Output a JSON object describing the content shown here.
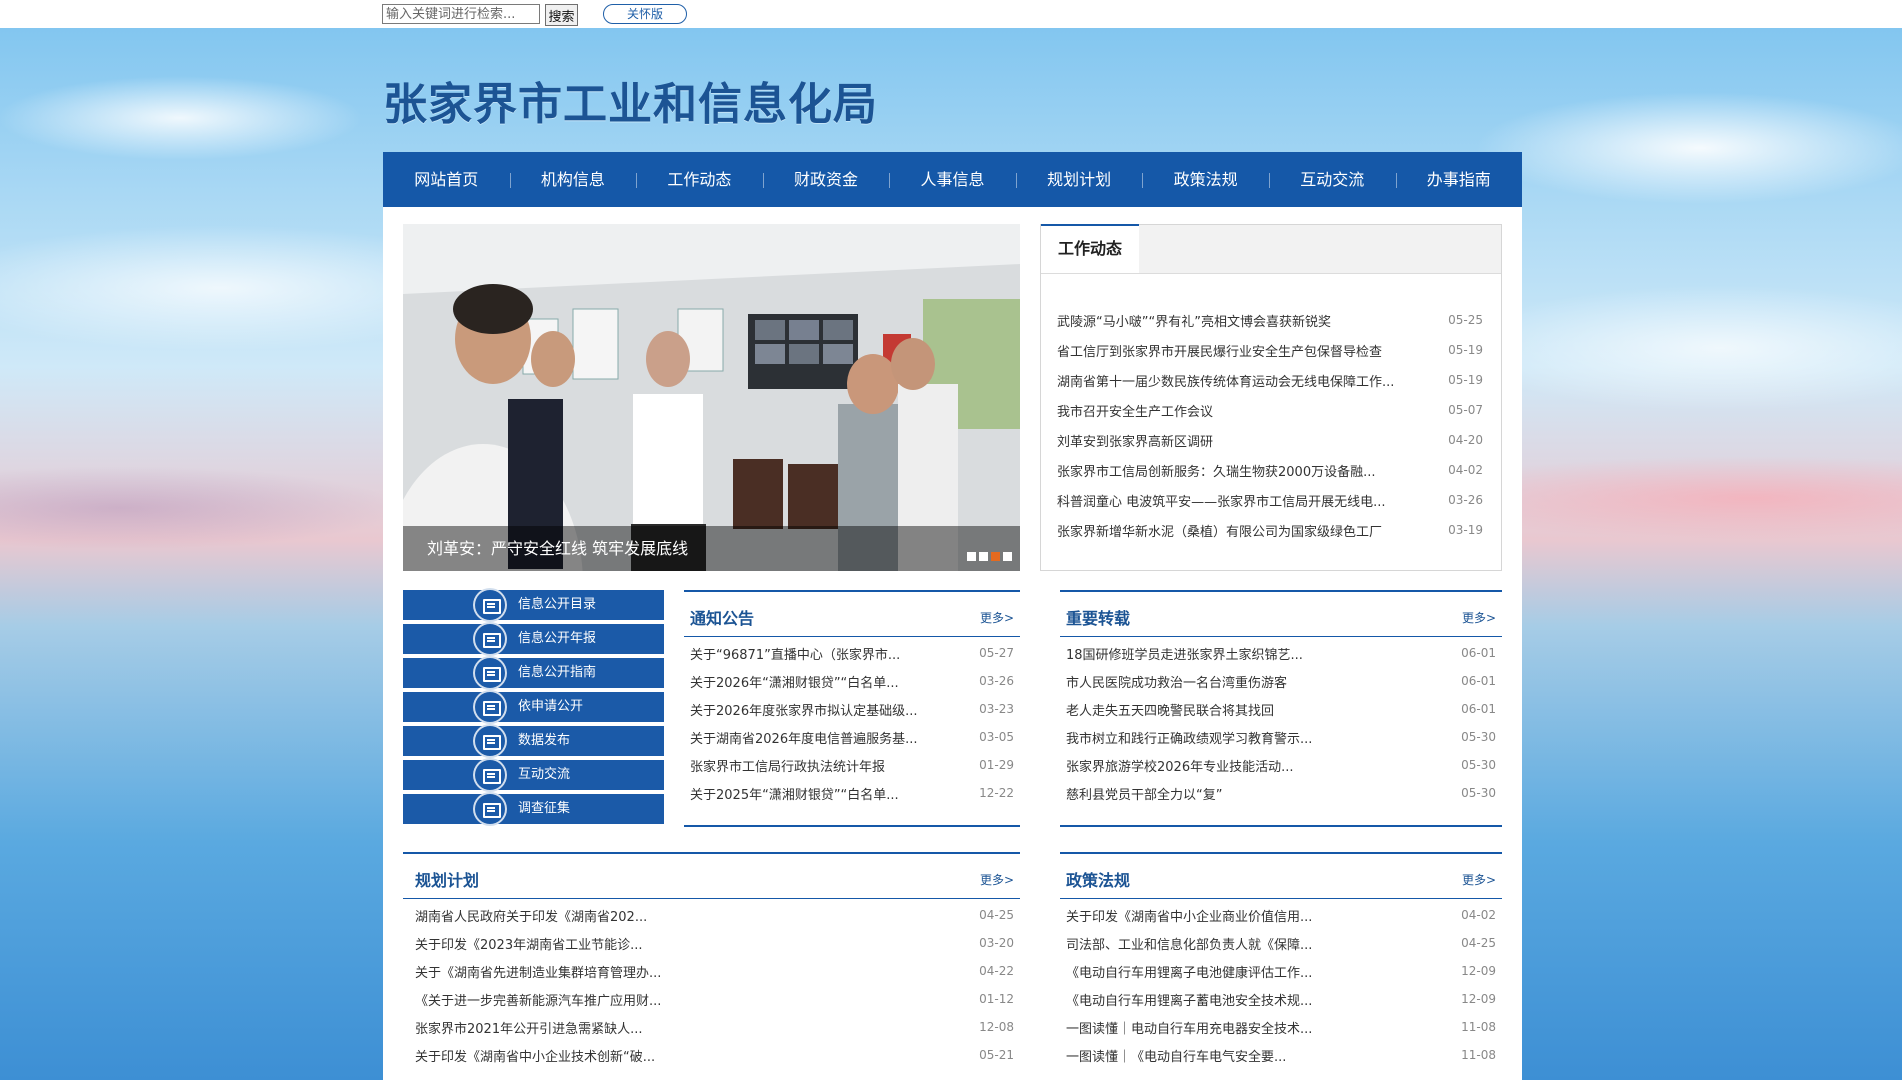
{
  "topbar": {
    "search_placeholder": "输入关键词进行检索...",
    "search_button": "搜索",
    "care_button": "关怀版"
  },
  "site": {
    "title": "张家界市工业和信息化局"
  },
  "nav": [
    "网站首页",
    "机构信息",
    "工作动态",
    "财政资金",
    "人事信息",
    "规划计划",
    "政策法规",
    "互动交流",
    "办事指南"
  ],
  "slider": {
    "caption": "刘革安：严守安全红线 筑牢发展底线",
    "slides_count": 4,
    "active_slide": 3
  },
  "work_news": {
    "tab": "工作动态",
    "items": [
      {
        "title": "武陵源“马小啵”“界有礼”亮相文博会喜获新锐奖",
        "date": "05-25"
      },
      {
        "title": "省工信厅到张家界市开展民爆行业安全生产包保督导检查",
        "date": "05-19"
      },
      {
        "title": "湖南省第十一届少数民族传统体育运动会无线电保障工作...",
        "date": "05-19"
      },
      {
        "title": "我市召开安全生产工作会议",
        "date": "05-07"
      },
      {
        "title": "刘革安到张家界高新区调研",
        "date": "04-20"
      },
      {
        "title": "张家界市工信局创新服务：久瑞生物获2000万设备融...",
        "date": "04-02"
      },
      {
        "title": "科普润童心 电波筑平安——张家界市工信局开展无线电...",
        "date": "03-26"
      },
      {
        "title": "张家界新增华新水泥（桑植）有限公司为国家级绿色工厂",
        "date": "03-19"
      }
    ]
  },
  "quick_links": [
    {
      "label": "信息公开目录",
      "icon": "document-icon"
    },
    {
      "label": "信息公开年报",
      "icon": "document-icon"
    },
    {
      "label": "信息公开指南",
      "icon": "guide-icon"
    },
    {
      "label": "依申请公开",
      "icon": "form-icon"
    },
    {
      "label": "数据发布",
      "icon": "chat-icon"
    },
    {
      "label": "互动交流",
      "icon": "chat-icon"
    },
    {
      "label": "调查征集",
      "icon": "survey-icon"
    }
  ],
  "notices": {
    "title": "通知公告",
    "more": "更多>",
    "items": [
      {
        "title": "关于“96871”直播中心（张家界市...",
        "date": "05-27"
      },
      {
        "title": "关于2026年“潇湘财银贷”“白名单...",
        "date": "03-26"
      },
      {
        "title": "关于2026年度张家界市拟认定基础级...",
        "date": "03-23"
      },
      {
        "title": "关于湖南省2026年度电信普遍服务基...",
        "date": "03-05"
      },
      {
        "title": "张家界市工信局行政执法统计年报",
        "date": "01-29"
      },
      {
        "title": "关于2025年“潇湘财银贷”“白名单...",
        "date": "12-22"
      }
    ]
  },
  "reposts": {
    "title": "重要转载",
    "more": "更多>",
    "items": [
      {
        "title": "18国研修班学员走进张家界土家织锦艺...",
        "date": "06-01"
      },
      {
        "title": "市人民医院成功救治一名台湾重伤游客",
        "date": "06-01"
      },
      {
        "title": "老人走失五天四晚警民联合将其找回",
        "date": "06-01"
      },
      {
        "title": "我市树立和践行正确政绩观学习教育警示...",
        "date": "05-30"
      },
      {
        "title": "张家界旅游学校2026年专业技能活动...",
        "date": "05-30"
      },
      {
        "title": "慈利县党员干部全力以“复”",
        "date": "05-30"
      }
    ]
  },
  "plans": {
    "title": "规划计划",
    "more": "更多>",
    "items": [
      {
        "title": "湖南省人民政府关于印发《湖南省202...",
        "date": "04-25"
      },
      {
        "title": "关于印发《2023年湖南省工业节能诊...",
        "date": "03-20"
      },
      {
        "title": "关于《湖南省先进制造业集群培育管理办...",
        "date": "04-22"
      },
      {
        "title": "《关于进一步完善新能源汽车推广应用财...",
        "date": "01-12"
      },
      {
        "title": "张家界市2021年公开引进急需紧缺人...",
        "date": "12-08"
      },
      {
        "title": "关于印发《湖南省中小企业技术创新“破...",
        "date": "05-21"
      }
    ]
  },
  "policies": {
    "title": "政策法规",
    "more": "更多>",
    "items": [
      {
        "title": "关于印发《湖南省中小企业商业价值信用...",
        "date": "04-02"
      },
      {
        "title": "司法部、工业和信息化部负责人就《保障...",
        "date": "04-25"
      },
      {
        "title": "《电动自行车用锂离子电池健康评估工作...",
        "date": "12-09"
      },
      {
        "title": "《电动自行车用锂离子蓄电池安全技术规...",
        "date": "12-09"
      },
      {
        "title": "一图读懂｜电动自行车用充电器安全技术...",
        "date": "11-08"
      },
      {
        "title": "一图读懂｜《电动自行车电气安全要...",
        "date": "11-08"
      }
    ]
  },
  "colors": {
    "brand": "#1558a8",
    "title": "#1c5494",
    "active_dot": "#e46a1f"
  }
}
